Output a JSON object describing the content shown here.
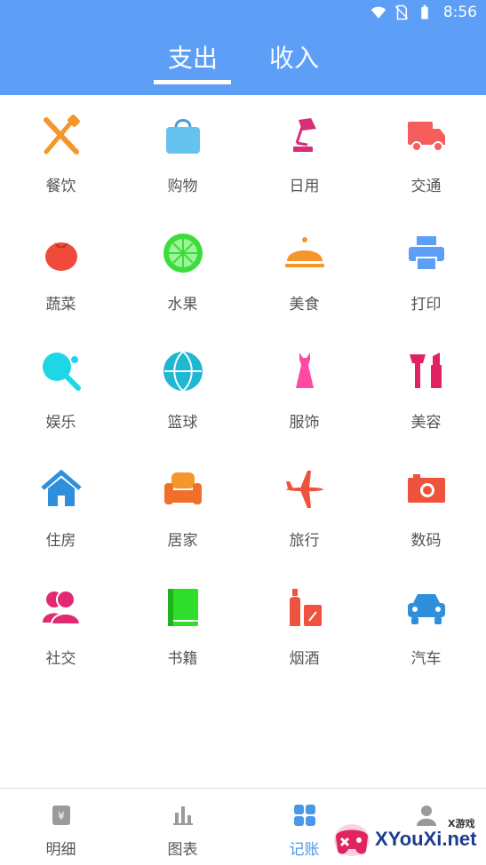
{
  "statusbar": {
    "time": "8:56",
    "icons": [
      "wifi-icon",
      "no-sim-icon",
      "battery-icon"
    ]
  },
  "tabs": {
    "expense": "支出",
    "income": "收入",
    "active": "expense"
  },
  "categories": [
    {
      "label": "餐饮",
      "icon": "fork-knife-icon",
      "color": "#f5962a"
    },
    {
      "label": "购物",
      "icon": "shopping-bag-icon",
      "color": "#66c3f0"
    },
    {
      "label": "日用",
      "icon": "desk-lamp-icon",
      "color": "#d62f78"
    },
    {
      "label": "交通",
      "icon": "truck-icon",
      "color": "#f65d5d"
    },
    {
      "label": "蔬菜",
      "icon": "tomato-icon",
      "color": "#f04a3a"
    },
    {
      "label": "水果",
      "icon": "lime-icon",
      "color": "#3ddb3b"
    },
    {
      "label": "美食",
      "icon": "cloche-icon",
      "color": "#f5962a"
    },
    {
      "label": "打印",
      "icon": "printer-icon",
      "color": "#5d9ef7"
    },
    {
      "label": "娱乐",
      "icon": "ping-pong-icon",
      "color": "#1ed6e6"
    },
    {
      "label": "篮球",
      "icon": "basketball-icon",
      "color": "#1fb7d2"
    },
    {
      "label": "服饰",
      "icon": "dress-icon",
      "color": "#ff4aa5"
    },
    {
      "label": "美容",
      "icon": "makeup-icon",
      "color": "#e02163"
    },
    {
      "label": "住房",
      "icon": "house-icon",
      "color": "#2f8fdd"
    },
    {
      "label": "居家",
      "icon": "sofa-icon",
      "color": "#f16f2a"
    },
    {
      "label": "旅行",
      "icon": "airplane-icon",
      "color": "#f0533d"
    },
    {
      "label": "数码",
      "icon": "camera-icon",
      "color": "#f0533d"
    },
    {
      "label": "社交",
      "icon": "people-icon",
      "color": "#e12a73"
    },
    {
      "label": "书籍",
      "icon": "book-icon",
      "color": "#2ede2a"
    },
    {
      "label": "烟酒",
      "icon": "bottle-icon",
      "color": "#f0533d"
    },
    {
      "label": "汽车",
      "icon": "car-icon",
      "color": "#2f8fdd"
    }
  ],
  "bottomnav": {
    "items": [
      {
        "label": "明细",
        "icon": "notebook-icon"
      },
      {
        "label": "图表",
        "icon": "bar-chart-icon"
      },
      {
        "label": "记账",
        "icon": "grid-icon"
      },
      {
        "label": "",
        "icon": "person-icon"
      }
    ],
    "active": "记账",
    "active_color": "#4c97ea"
  },
  "watermark": {
    "small": "X游戏",
    "text": "XYouXi.net"
  },
  "colors": {
    "header": "#5d9ef7"
  }
}
